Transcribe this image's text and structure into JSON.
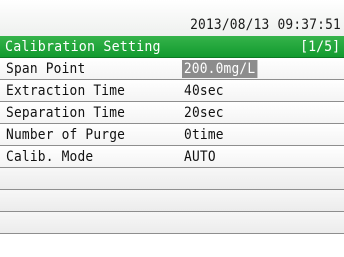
{
  "status": {
    "timestamp": "2013/08/13 09:37:51"
  },
  "header": {
    "title": "Calibration Setting",
    "page": "[1/5]"
  },
  "settings": [
    {
      "label": "Span Point",
      "value": "200.0mg/L"
    },
    {
      "label": "Extraction Time",
      "value": "40sec"
    },
    {
      "label": "Separation Time",
      "value": "20sec"
    },
    {
      "label": "Number of Purge",
      "value": "0time"
    },
    {
      "label": "Calib. Mode",
      "value": "AUTO"
    }
  ],
  "colors": {
    "title_bar": "#1fa53a",
    "selection": "#8c8c8c"
  }
}
